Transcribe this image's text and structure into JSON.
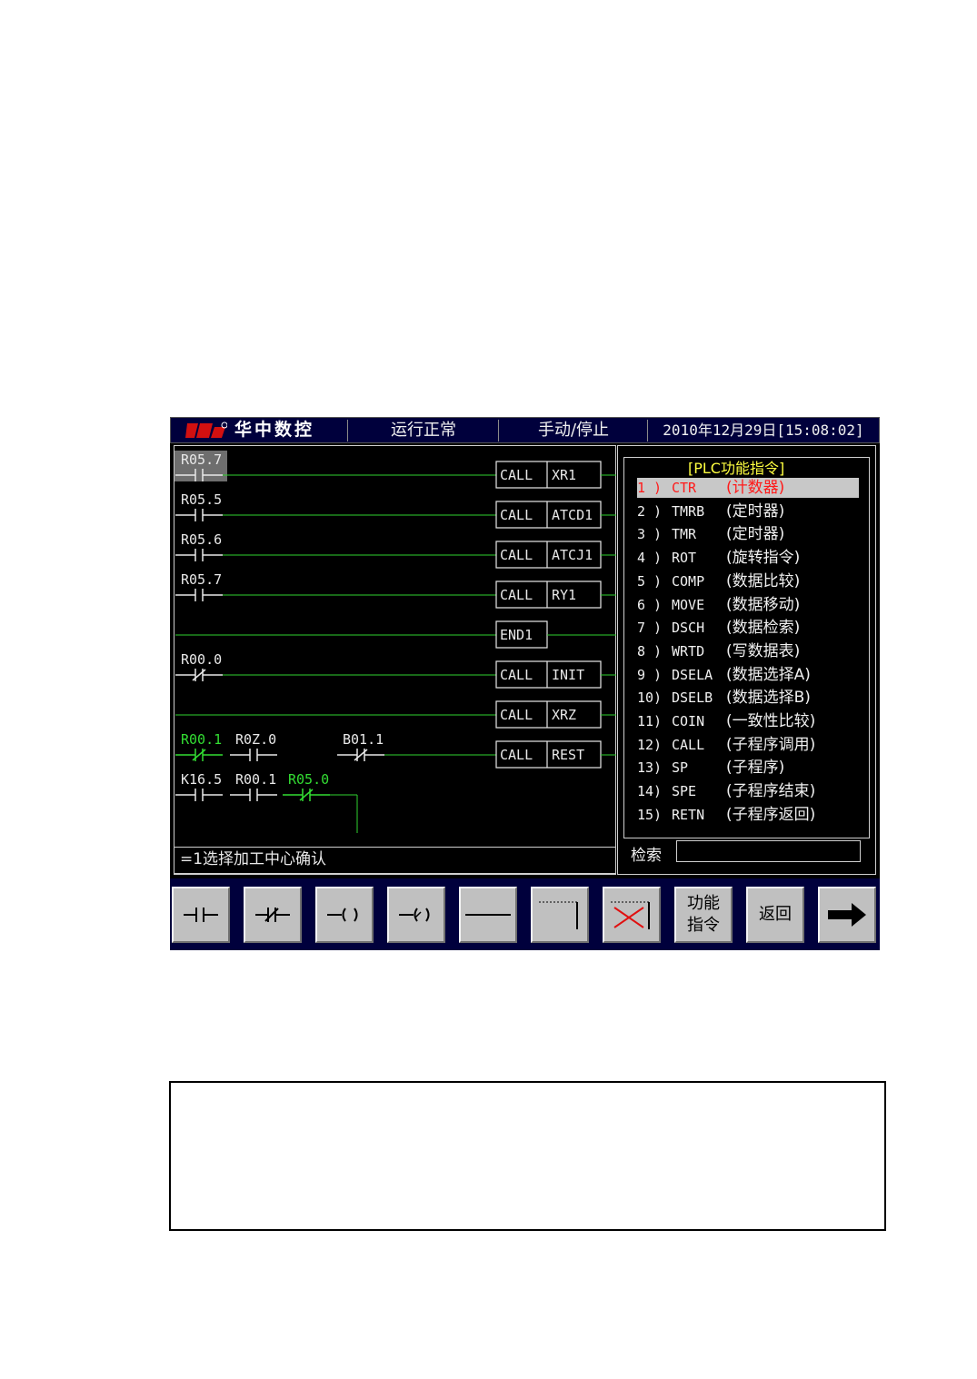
{
  "header": {
    "brand": "华中数控",
    "status": "运行正常",
    "mode": "手动/停止",
    "datetime": "2010年12月29日[15:08:02]"
  },
  "colors": {
    "screen_bg": "#000000",
    "header_bg": "#00003c",
    "rung_line": "#2fd22f",
    "active_contact": "#33dd33",
    "selected_text": "#ff1a1a",
    "title_text": "#ffff40",
    "button_face": "#c0c0c0"
  },
  "ladder": {
    "rungs": [
      {
        "contacts": [
          {
            "label": "R05.7",
            "type": "no",
            "highlight": true
          }
        ],
        "output": {
          "op": "CALL",
          "arg": "XR1"
        }
      },
      {
        "contacts": [
          {
            "label": "R05.5",
            "type": "no"
          }
        ],
        "output": {
          "op": "CALL",
          "arg": "ATCD1"
        }
      },
      {
        "contacts": [
          {
            "label": "R05.6",
            "type": "no"
          }
        ],
        "output": {
          "op": "CALL",
          "arg": "ATCJ1"
        }
      },
      {
        "contacts": [
          {
            "label": "R05.7",
            "type": "no"
          }
        ],
        "output": {
          "op": "CALL",
          "arg": "RY1"
        }
      },
      {
        "contacts": [],
        "output": {
          "op": "END1",
          "arg": ""
        }
      },
      {
        "contacts": [
          {
            "label": "R00.0",
            "type": "nc"
          }
        ],
        "output": {
          "op": "CALL",
          "arg": "INIT"
        }
      },
      {
        "contacts": [],
        "output": {
          "op": "CALL",
          "arg": "XRZ"
        }
      },
      {
        "contacts": [
          {
            "label": "R00.1",
            "type": "nc",
            "active": true
          },
          {
            "label": "R0Z.0",
            "type": "no"
          },
          {
            "label": "B01.1",
            "type": "nc"
          }
        ],
        "output": {
          "op": "CALL",
          "arg": "REST"
        }
      },
      {
        "contacts": [
          {
            "label": "K16.5",
            "type": "no"
          },
          {
            "label": "R00.1",
            "type": "no"
          },
          {
            "label": "R05.0",
            "type": "nc",
            "active": true
          }
        ],
        "output": null
      }
    ],
    "status_line": "=1选择加工中心确认"
  },
  "functions": {
    "title": "[PLC功能指令]",
    "selected_index": 0,
    "items": [
      {
        "num": "1 )",
        "code": "CTR",
        "desc": "(计数器)"
      },
      {
        "num": "2 )",
        "code": "TMRB",
        "desc": "(定时器)"
      },
      {
        "num": "3 )",
        "code": "TMR",
        "desc": "(定时器)"
      },
      {
        "num": "4 )",
        "code": "ROT",
        "desc": "(旋转指令)"
      },
      {
        "num": "5 )",
        "code": "COMP",
        "desc": "(数据比较)"
      },
      {
        "num": "6 )",
        "code": "MOVE",
        "desc": "(数据移动)"
      },
      {
        "num": "7 )",
        "code": "DSCH",
        "desc": "(数据检索)"
      },
      {
        "num": "8 )",
        "code": "WRTD",
        "desc": "(写数据表)"
      },
      {
        "num": "9 )",
        "code": "DSELA",
        "desc": "(数据选择A)"
      },
      {
        "num": "10)",
        "code": "DSELB",
        "desc": "(数据选择B)"
      },
      {
        "num": "11)",
        "code": "COIN",
        "desc": "(一致性比较)"
      },
      {
        "num": "12)",
        "code": "CALL",
        "desc": "(子程序调用)"
      },
      {
        "num": "13)",
        "code": "SP",
        "desc": "(子程序)"
      },
      {
        "num": "14)",
        "code": "SPE",
        "desc": "(子程序结束)"
      },
      {
        "num": "15)",
        "code": "RETN",
        "desc": "(子程序返回)"
      }
    ],
    "search_label": "检索",
    "search_value": ""
  },
  "fkeys": [
    {
      "name": "no-contact-button",
      "icon": "normally-open-contact-icon"
    },
    {
      "name": "nc-contact-button",
      "icon": "normally-closed-contact-icon"
    },
    {
      "name": "coil-button",
      "icon": "coil-icon"
    },
    {
      "name": "not-coil-button",
      "icon": "negated-coil-icon"
    },
    {
      "name": "hline-button",
      "icon": "horizontal-line-icon"
    },
    {
      "name": "vline-button",
      "icon": "vertical-line-icon"
    },
    {
      "name": "delete-line-button",
      "icon": "delete-line-icon"
    },
    {
      "name": "function-instruction-button",
      "label1": "功能",
      "label2": "指令"
    },
    {
      "name": "back-button",
      "label": "返回"
    },
    {
      "name": "next-button",
      "icon": "right-arrow-icon"
    }
  ]
}
